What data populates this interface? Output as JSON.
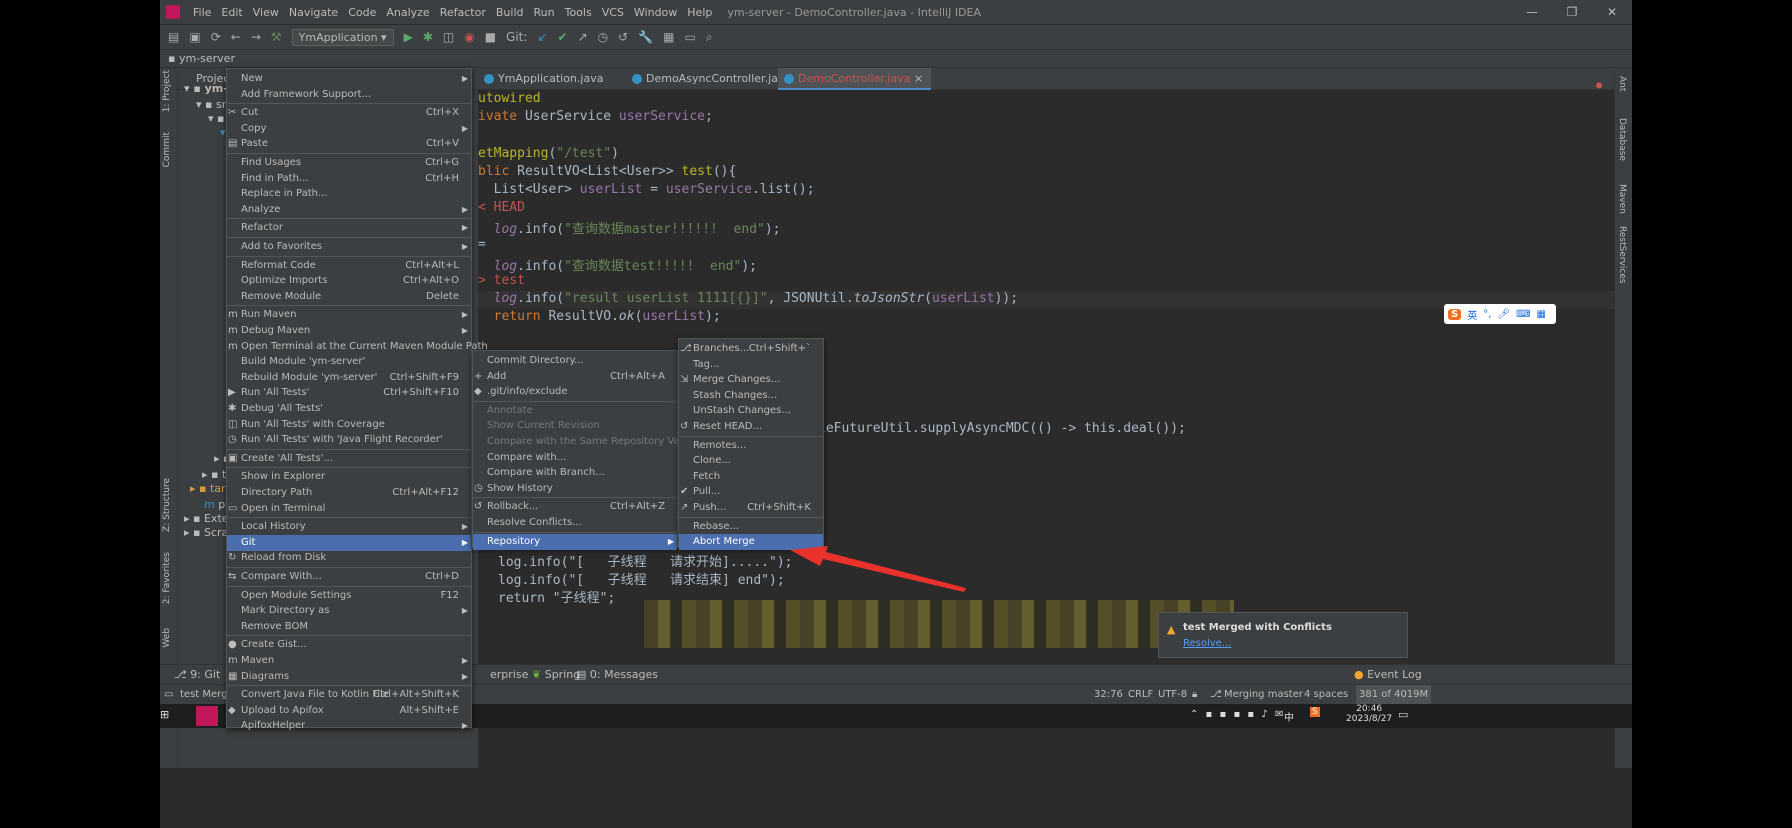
{
  "window": {
    "title": "ym-server - DemoController.java - IntelliJ IDEA",
    "menu": [
      "File",
      "Edit",
      "View",
      "Navigate",
      "Code",
      "Analyze",
      "Refactor",
      "Build",
      "Run",
      "Tools",
      "VCS",
      "Window",
      "Help"
    ]
  },
  "toolbar": {
    "run_config": "YmApplication",
    "git_label": "Git:"
  },
  "navbar": {
    "project": "ym-server"
  },
  "project_panel": {
    "header": "Project",
    "tree": [
      "ym-serve",
      "src",
      "ma",
      "tes",
      "test",
      "target",
      "pom.x",
      "External L",
      "Scratches"
    ]
  },
  "tabs": [
    "YmApplication.java",
    "DemoAsyncController.java",
    "DemoController.java"
  ],
  "editor": {
    "lines": [
      {
        "parts": [
          [
            "an",
            "utowired"
          ]
        ]
      },
      {
        "parts": [
          [
            "kw",
            "ivate "
          ],
          [
            "",
            "UserService "
          ],
          [
            "fd",
            "userService"
          ],
          [
            "",
            ";"
          ]
        ]
      },
      {
        "parts": []
      },
      {
        "parts": [
          [
            "an",
            "etMapping"
          ],
          [
            "",
            "("
          ],
          [
            "st",
            "\"/test\""
          ],
          [
            "",
            ")"
          ]
        ]
      },
      {
        "parts": [
          [
            "kw",
            "blic "
          ],
          [
            "",
            "ResultVO<List<User>> "
          ],
          [
            "an",
            "test"
          ],
          [
            "",
            "(){"
          ]
        ]
      },
      {
        "parts": [
          [
            "",
            "  List<User> "
          ],
          [
            "fd",
            "userList"
          ],
          [
            "",
            " = "
          ],
          [
            "fd",
            "userService"
          ],
          [
            "",
            ".list();"
          ]
        ]
      },
      {
        "parts": [
          [
            "cf",
            "< HEAD"
          ]
        ]
      },
      {
        "parts": [
          [
            "",
            "  "
          ],
          [
            "fd it",
            "log"
          ],
          [
            "",
            ".info("
          ],
          [
            "st",
            "\"查询数据master!!!!!!  end\""
          ],
          [
            "",
            ");"
          ]
        ]
      },
      {
        "parts": [
          [
            "",
            "="
          ]
        ]
      },
      {
        "parts": [
          [
            "",
            "  "
          ],
          [
            "fd it",
            "log"
          ],
          [
            "",
            ".info("
          ],
          [
            "st",
            "\"查询数据test!!!!!  end\""
          ],
          [
            "",
            ");"
          ]
        ]
      },
      {
        "parts": [
          [
            "cf",
            "> test"
          ]
        ]
      },
      {
        "parts": [
          [
            "",
            "  "
          ],
          [
            "fd it",
            "log"
          ],
          [
            "",
            ".info("
          ],
          [
            "st",
            "\"result userList 1111[{}]\""
          ],
          [
            "",
            ", JSONUtil."
          ],
          [
            "it",
            "toJsonStr"
          ],
          [
            "",
            "("
          ],
          [
            "fd",
            "userList"
          ],
          [
            "",
            "));"
          ]
        ]
      },
      {
        "parts": [
          [
            "kw",
            "  return "
          ],
          [
            "",
            "ResultVO."
          ],
          [
            "it",
            "ok"
          ],
          [
            "",
            "("
          ],
          [
            "fd",
            "userList"
          ],
          [
            "",
            ");"
          ]
        ]
      }
    ],
    "async_line": "leFutureUtil.supplyAsyncMDC(() -> this.deal());",
    "async_line_this": "this",
    "async_line_deal": ".deal()",
    "bottom_lines": [
      "log.info(\"[   子线程   请求开始].....\");",
      "log.info(\"[   子线程   请求结束] end\");",
      "return \"子线程\";"
    ]
  },
  "context_menu": [
    {
      "label": "New",
      "arrow": true
    },
    {
      "label": "Add Framework Support..."
    },
    {
      "sep": true
    },
    {
      "label": "Cut",
      "shortcut": "Ctrl+X",
      "icon": "cut-icon"
    },
    {
      "label": "Copy",
      "arrow": true
    },
    {
      "label": "Paste",
      "shortcut": "Ctrl+V",
      "icon": "paste-icon"
    },
    {
      "sep": true
    },
    {
      "label": "Find Usages",
      "shortcut": "Ctrl+G"
    },
    {
      "label": "Find in Path...",
      "shortcut": "Ctrl+H"
    },
    {
      "label": "Replace in Path..."
    },
    {
      "label": "Analyze",
      "arrow": true
    },
    {
      "sep": true
    },
    {
      "label": "Refactor",
      "arrow": true
    },
    {
      "sep": true
    },
    {
      "label": "Add to Favorites",
      "arrow": true
    },
    {
      "sep": true
    },
    {
      "label": "Reformat Code",
      "shortcut": "Ctrl+Alt+L"
    },
    {
      "label": "Optimize Imports",
      "shortcut": "Ctrl+Alt+O"
    },
    {
      "label": "Remove Module",
      "shortcut": "Delete"
    },
    {
      "sep": true
    },
    {
      "label": "Run Maven",
      "arrow": true,
      "icon": "maven-icon"
    },
    {
      "label": "Debug Maven",
      "arrow": true,
      "icon": "maven-icon"
    },
    {
      "label": "Open Terminal at the Current Maven Module Path",
      "icon": "maven-icon"
    },
    {
      "label": "Build Module 'ym-server'"
    },
    {
      "label": "Rebuild Module 'ym-server'",
      "shortcut": "Ctrl+Shift+F9"
    },
    {
      "label": "Run 'All Tests'",
      "shortcut": "Ctrl+Shift+F10",
      "icon": "run-icon"
    },
    {
      "label": "Debug 'All Tests'",
      "icon": "debug-icon"
    },
    {
      "label": "Run 'All Tests' with Coverage",
      "icon": "coverage-icon"
    },
    {
      "label": "Run 'All Tests' with 'Java Flight Recorder'",
      "icon": "profiler-icon"
    },
    {
      "sep": true
    },
    {
      "label": "Create 'All Tests'...",
      "icon": "test-icon"
    },
    {
      "sep": true
    },
    {
      "label": "Show in Explorer"
    },
    {
      "label": "Directory Path",
      "shortcut": "Ctrl+Alt+F12"
    },
    {
      "label": "Open in Terminal",
      "icon": "terminal-icon"
    },
    {
      "sep": true
    },
    {
      "label": "Local History",
      "arrow": true
    },
    {
      "label": "Git",
      "arrow": true,
      "selected": true
    },
    {
      "label": "Reload from Disk",
      "icon": "reload-icon"
    },
    {
      "sep": true
    },
    {
      "label": "Compare With...",
      "shortcut": "Ctrl+D",
      "icon": "compare-icon"
    },
    {
      "sep": true
    },
    {
      "label": "Open Module Settings",
      "shortcut": "F12"
    },
    {
      "label": "Mark Directory as",
      "arrow": true
    },
    {
      "label": "Remove BOM"
    },
    {
      "sep": true
    },
    {
      "label": "Create Gist...",
      "icon": "github-icon"
    },
    {
      "label": "Maven",
      "arrow": true,
      "icon": "maven-icon"
    },
    {
      "label": "Diagrams",
      "arrow": true,
      "icon": "diagram-icon"
    },
    {
      "sep": true
    },
    {
      "label": "Convert Java File to Kotlin File",
      "shortcut": "Ctrl+Alt+Shift+K"
    },
    {
      "label": "Upload to Apifox",
      "shortcut": "Alt+Shift+E",
      "icon": "apifox-icon"
    },
    {
      "label": "ApifoxHelper",
      "arrow": true
    }
  ],
  "git_menu": [
    {
      "label": "Commit Directory..."
    },
    {
      "label": "Add",
      "shortcut": "Ctrl+Alt+A",
      "icon": "plus-icon"
    },
    {
      "label": ".git/info/exclude",
      "icon": "git-icon"
    },
    {
      "sep": true
    },
    {
      "label": "Annotate",
      "disabled": true
    },
    {
      "label": "Show Current Revision",
      "disabled": true
    },
    {
      "label": "Compare with the Same Repository Version",
      "disabled": true
    },
    {
      "label": "Compare with..."
    },
    {
      "label": "Compare with Branch..."
    },
    {
      "label": "Show History",
      "icon": "history-icon"
    },
    {
      "sep": true
    },
    {
      "label": "Rollback...",
      "shortcut": "Ctrl+Alt+Z",
      "icon": "rollback-icon"
    },
    {
      "label": "Resolve Conflicts..."
    },
    {
      "sep": true
    },
    {
      "label": "Repository",
      "arrow": true,
      "selected": true
    }
  ],
  "repo_menu": [
    {
      "label": "Branches...",
      "shortcut": "Ctrl+Shift+`",
      "icon": "branch-icon"
    },
    {
      "label": "Tag..."
    },
    {
      "label": "Merge Changes...",
      "icon": "merge-icon"
    },
    {
      "label": "Stash Changes..."
    },
    {
      "label": "UnStash Changes..."
    },
    {
      "label": "Reset HEAD...",
      "icon": "reset-icon"
    },
    {
      "sep": true
    },
    {
      "label": "Remotes..."
    },
    {
      "label": "Clone..."
    },
    {
      "label": "Fetch"
    },
    {
      "label": "Pull...",
      "icon": "pull-icon"
    },
    {
      "label": "Push...",
      "shortcut": "Ctrl+Shift+K",
      "icon": "push-icon"
    },
    {
      "sep": true
    },
    {
      "label": "Rebase..."
    },
    {
      "label": "Abort Merge",
      "selected": true
    }
  ],
  "bottom_tabs": [
    "9: Git",
    "erprise",
    "Spring",
    "0: Messages",
    "Event Log"
  ],
  "status": {
    "left": "test Merged wi",
    "position": "32:76",
    "line_sep": "CRLF",
    "encoding": "UTF-8",
    "git": "Merging master",
    "indent": "4 spaces",
    "memory": "381 of 4019M"
  },
  "notification": {
    "title": "test Merged with Conflicts",
    "link": "Resolve..."
  },
  "taskbar": {
    "time": "20:46",
    "date": "2023/8/27",
    "ime": "英"
  },
  "left_stripe": [
    "1: Project",
    "Commit",
    "Z: Structure",
    "2: Favorites",
    "Web"
  ],
  "right_stripe": [
    "Ant",
    "Database",
    "Maven",
    "RestServices"
  ],
  "colors": {
    "selection": "#4b6eaf",
    "arrow": "#e8322b",
    "conflict": "#c75450"
  }
}
